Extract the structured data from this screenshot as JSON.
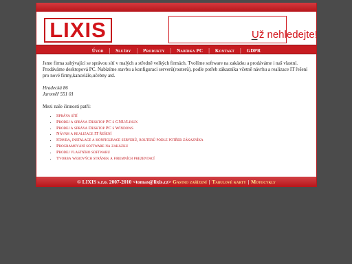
{
  "logo": {
    "text": "LIXIS"
  },
  "banner": {
    "text": "Už nehledejte!",
    "cursor": "_"
  },
  "nav": {
    "items": [
      {
        "label": "Úvod"
      },
      {
        "label": "Služby"
      },
      {
        "label": "Produkty"
      },
      {
        "label": "Nabídka PC"
      },
      {
        "label": "Kontakt"
      },
      {
        "label": "GDPR"
      }
    ],
    "separator": "|"
  },
  "content": {
    "intro": "Jsme firma zabývající se správou sítí v malých a středně velkých firmách. Tvoříme software na zakázku a prodáváme i naš vlastní. Prodáváme desktopová PC. Nabízíme stavbu a konfiguraci serverů(routerů), podle potřeb zákazníka včetně návrhu a realizace IT řešení pro nové firmy,kanceláře,učebny atd.",
    "address_line1": "Hradecká 86",
    "address_line2": "Jaroměř 551 01",
    "activities_heading": "Mezi naše činnosti patří:",
    "services": [
      "Správa sítí",
      "Prodej a správa Desktop PC s GNU/Linux",
      "Prodej a správa Desktop PC s Windows",
      "Návrh a realizace IT řešení",
      "Stavba, instalace a konfigurace serverů, routerů podle potřeb zákazníka",
      "Programování software na zakázku",
      "Prodej vlastního softwaru",
      "Tvorba webových stránek a firemních prezentací"
    ]
  },
  "footer": {
    "copyright": "© LIXIS s.r.o. 2007-2010 <tomas@lixis.cz>",
    "links": [
      {
        "label": "Gastro zařízení"
      },
      {
        "label": "Tabulové karty"
      },
      {
        "label": "Motocykly"
      }
    ],
    "separator": "|"
  },
  "colors": {
    "brand_red": "#c71c21",
    "background": "#4b4b4b",
    "link_red": "#c0141a"
  }
}
